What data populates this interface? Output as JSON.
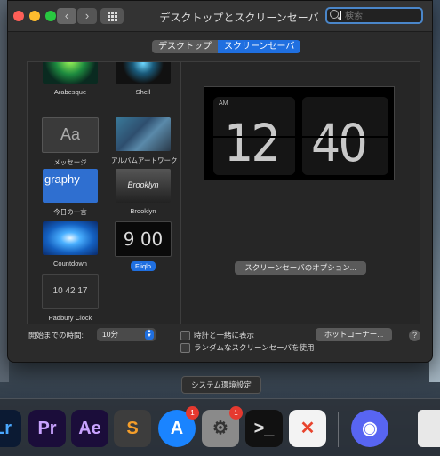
{
  "window": {
    "title": "デスクトップとスクリーンセーバ",
    "search_placeholder": "検索"
  },
  "tabs": [
    {
      "label": "デスクトップ",
      "active": false
    },
    {
      "label": "スクリーンセーバ",
      "active": true
    }
  ],
  "screensavers": [
    {
      "label": "Arabesque"
    },
    {
      "label": "Shell"
    },
    {
      "label": "メッセージ",
      "thumb_text": "Aa"
    },
    {
      "label": "アルバムアートワーク"
    },
    {
      "label": "今日の一言",
      "thumb_text": "graphy"
    },
    {
      "label": "Brooklyn",
      "thumb_text": "Brooklyn"
    },
    {
      "label": "Countdown"
    },
    {
      "label": "Fliqlo",
      "thumb_text": "9 00",
      "selected": true
    },
    {
      "label": "Padbury Clock",
      "thumb_text": "10 42 17"
    }
  ],
  "preview": {
    "ampm": "AM",
    "hour": "12",
    "minute": "40",
    "options_button": "スクリーンセーバのオプション..."
  },
  "bottom": {
    "start_after_label": "開始までの時間:",
    "start_after_value": "10分",
    "show_clock_label": "時計と一緒に表示",
    "random_label": "ランダムなスクリーンセーバを使用",
    "hot_corners_button": "ホットコーナー...",
    "help": "?"
  },
  "tooltip": "システム環境設定",
  "dock": {
    "apps": [
      {
        "name": "Lightroom",
        "text": "Lr",
        "color": "#0b1a33",
        "fg": "#4aa8ff"
      },
      {
        "name": "Premiere Pro",
        "text": "Pr",
        "color": "#1b0d3a",
        "fg": "#c9a3ff"
      },
      {
        "name": "After Effects",
        "text": "Ae",
        "color": "#1b0d3a",
        "fg": "#c9a3ff"
      },
      {
        "name": "Sublime Text",
        "text": "S",
        "color": "#3d3d3d",
        "fg": "#f59e2a"
      },
      {
        "name": "App Store",
        "text": "A",
        "color": "#1a84ff",
        "fg": "#ffffff",
        "badge": "1"
      },
      {
        "name": "System Preferences",
        "text": "⚙",
        "color": "#8a8a8a",
        "fg": "#333333",
        "badge": "1"
      },
      {
        "name": "Terminal",
        "text": ">_",
        "color": "#111111",
        "fg": "#dddddd"
      },
      {
        "name": "XMind",
        "text": "✕",
        "color": "#f3f3f3",
        "fg": "#e8442e"
      },
      {
        "name": "Discord",
        "text": "◉",
        "color": "#5865f2",
        "fg": "#ffffff"
      },
      {
        "name": "Document",
        "text": "",
        "color": "#e8e8e8",
        "fg": "#888888"
      }
    ]
  }
}
